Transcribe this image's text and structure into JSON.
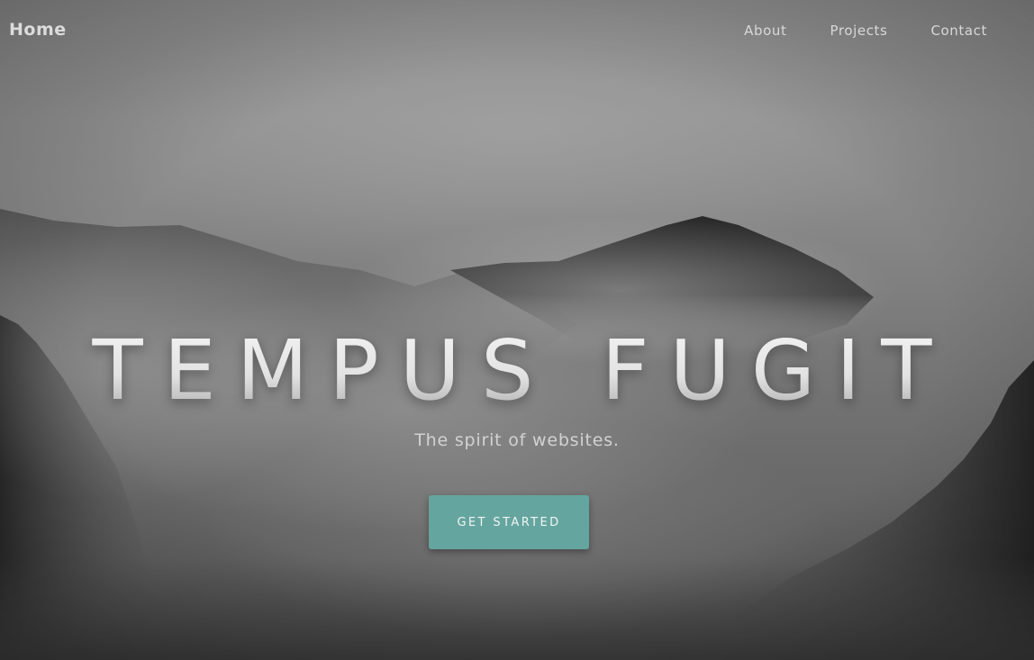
{
  "nav": {
    "brand": "Home",
    "links": [
      {
        "label": "About"
      },
      {
        "label": "Projects"
      },
      {
        "label": "Contact"
      }
    ]
  },
  "hero": {
    "title": "TEMPUS FUGIT",
    "subtitle": "The spirit of websites.",
    "cta_label": "GET STARTED"
  },
  "colors": {
    "accent": "#65a59f",
    "nav_text": "#d8d8d8",
    "title_text": "#ededed"
  },
  "background": {
    "image": "misty-mountains-photo"
  }
}
